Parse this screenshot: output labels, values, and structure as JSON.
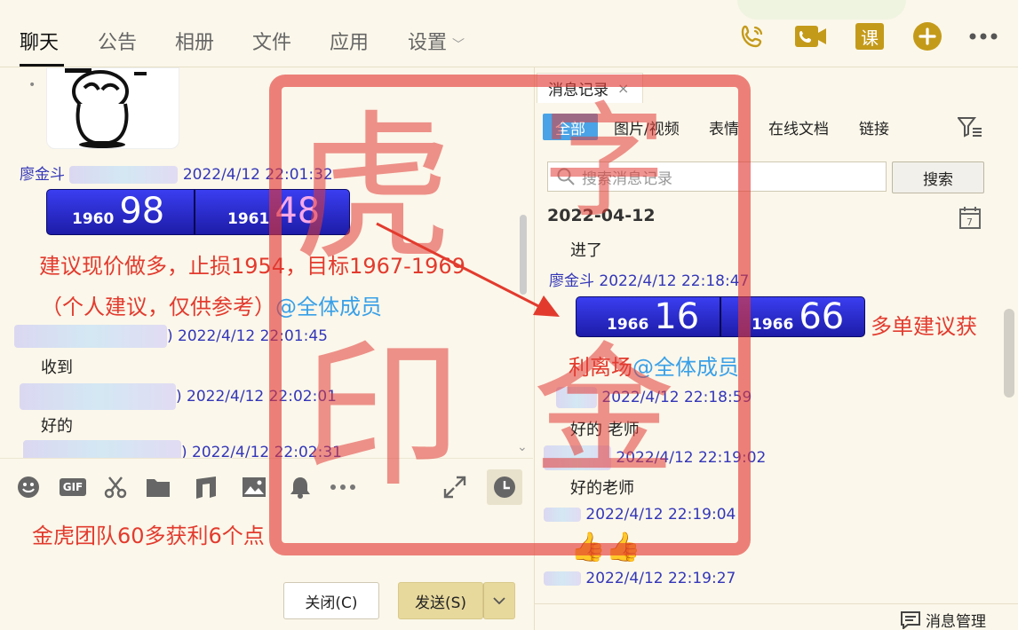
{
  "nav": {
    "tabs": [
      "聊天",
      "公告",
      "相册",
      "文件",
      "应用",
      "设置"
    ],
    "active": 0
  },
  "top_icons": {
    "ke_label": "课"
  },
  "chat": {
    "m1": {
      "sender": "廖金斗",
      "time": "2022/4/12 22:01:32",
      "ticker": {
        "left_small": "1960",
        "left_big": "98",
        "right_small": "1961",
        "right_big": "48"
      },
      "line1": "建议现价做多，止损1954，目标1967-1969",
      "line2_prefix": "（个人建议，仅供参考）",
      "line2_at": "@全体成员"
    },
    "m2": {
      "time_prefix": ")",
      "time": "2022/4/12 22:01:45",
      "text": "收到"
    },
    "m3": {
      "time_prefix": ")",
      "time": "2022/4/12 22:02:01",
      "text": "好的"
    },
    "m4": {
      "time_prefix": ")",
      "time": "2022/4/12 22:02:31"
    }
  },
  "compose": {
    "text": "金虎团队60多获利6个点"
  },
  "buttons": {
    "close": "关闭(C)",
    "send": "发送(S)"
  },
  "history": {
    "tab": "消息记录",
    "tab_close": "×",
    "filters": [
      "全部",
      "图片/视频",
      "表情",
      "在线文档",
      "链接"
    ],
    "search_placeholder": "搜索消息记录",
    "search_btn": "搜索",
    "date": "2022-04-12",
    "first_text": "进了",
    "r1": {
      "sender": "廖金斗",
      "time": "2022/4/12 22:18:47",
      "ticker": {
        "left_small": "1966",
        "left_big": "16",
        "right_small": "1966",
        "right_big": "66"
      },
      "side_text": "多单建议获",
      "line2_prefix": "利离场",
      "line2_at": "@全体成员"
    },
    "r2": {
      "time": "2022/4/12 22:18:59",
      "text": "好的 老师"
    },
    "r3": {
      "time": "2022/4/12 22:19:02",
      "text": "好的老师"
    },
    "r4": {
      "time": "2022/4/12 22:19:04",
      "emoji": "👍👍"
    },
    "r5": {
      "time": "2022/4/12 22:19:27"
    },
    "manage": "消息管理"
  },
  "watermark": {
    "chars": [
      "虎",
      "字",
      "印",
      "金"
    ]
  },
  "colors": {
    "accent": "#4aa3e6",
    "red": "#e23b2e",
    "blue": "#3336b8",
    "gold": "#c49a1a"
  }
}
